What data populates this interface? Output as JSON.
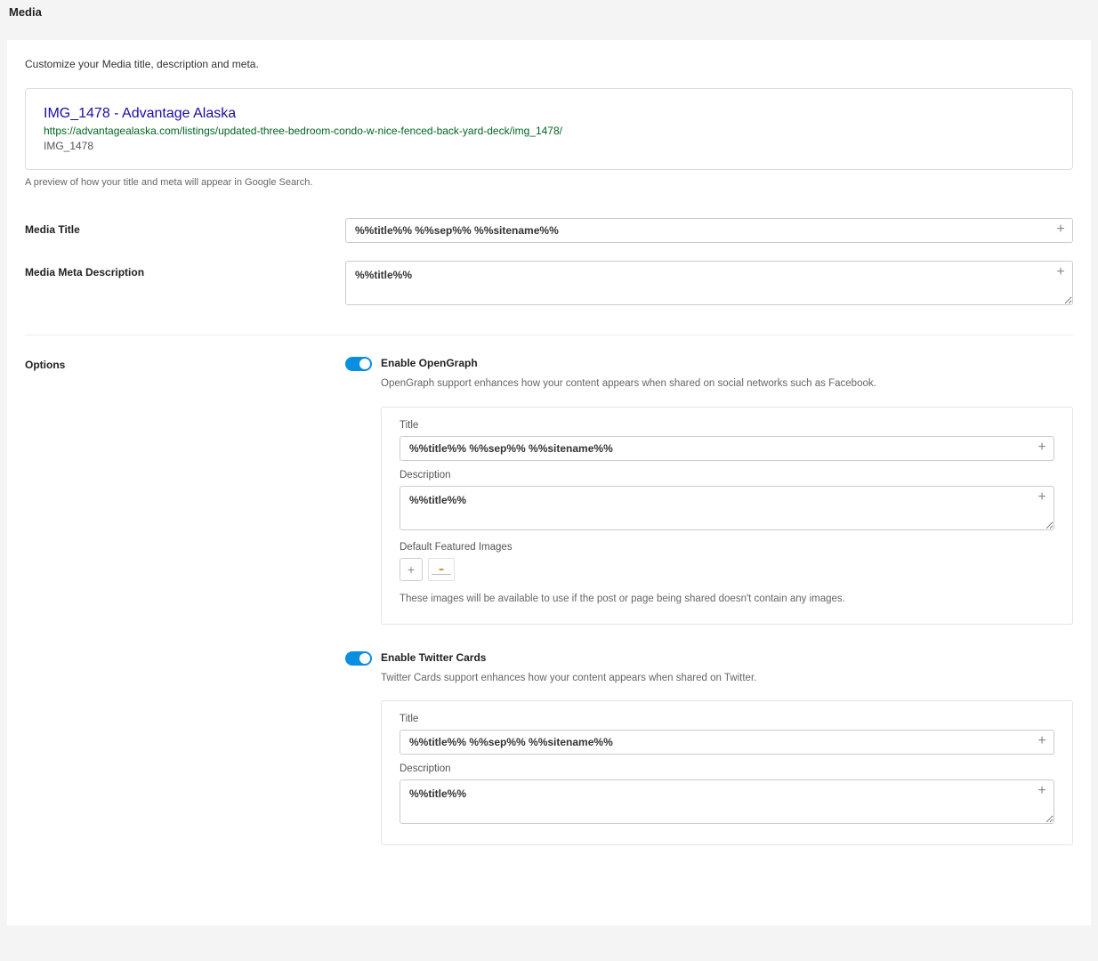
{
  "header": "Media",
  "intro": "Customize your Media title, description and meta.",
  "preview": {
    "title": "IMG_1478 - Advantage Alaska",
    "url": "https://advantagealaska.com/listings/updated-three-bedroom-condo-w-nice-fenced-back-yard-deck/img_1478/",
    "snippet": "IMG_1478",
    "caption": "A preview of how your title and meta will appear in Google Search."
  },
  "fields": {
    "media_title_label": "Media Title",
    "media_title_value": "%%title%% %%sep%% %%sitename%%",
    "media_desc_label": "Media Meta Description",
    "media_desc_value": "%%title%%"
  },
  "options_label": "Options",
  "og": {
    "toggle_label": "Enable OpenGraph",
    "desc": "OpenGraph support enhances how your content appears when shared on social networks such as Facebook.",
    "title_label": "Title",
    "title_value": "%%title%% %%sep%% %%sitename%%",
    "desc_label": "Description",
    "desc_value": "%%title%%",
    "images_label": "Default Featured Images",
    "images_note": "These images will be available to use if the post or page being shared doesn't contain any images."
  },
  "tw": {
    "toggle_label": "Enable Twitter Cards",
    "desc": "Twitter Cards support enhances how your content appears when shared on Twitter.",
    "title_label": "Title",
    "title_value": "%%title%% %%sep%% %%sitename%%",
    "desc_label": "Description",
    "desc_value": "%%title%%"
  },
  "icons": {
    "plus": "+"
  }
}
